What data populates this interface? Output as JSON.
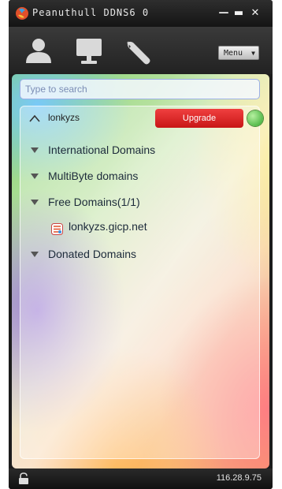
{
  "window": {
    "title": "Peanuthull DDNS6 0",
    "controls": {
      "minimize": "—",
      "maximize": "▬",
      "close": "✕"
    }
  },
  "toolbar": {
    "items": [
      {
        "icon": "user-icon"
      },
      {
        "icon": "monitor-icon"
      },
      {
        "icon": "wrench-icon"
      }
    ],
    "menu_label": "Menu",
    "menu_caret": "▼"
  },
  "search": {
    "placeholder": "Type to search",
    "value": ""
  },
  "account": {
    "name": "lonkyzs",
    "upgrade_label": "Upgrade",
    "status_color": "#2fa52a"
  },
  "groups": [
    {
      "label": "International Domains",
      "expanded": true
    },
    {
      "label": "MultiByte domains",
      "expanded": true
    },
    {
      "label": "Free Domains(1/1)",
      "expanded": true,
      "domains": [
        "lonkyzs.gicp.net"
      ]
    },
    {
      "label": "Donated Domains",
      "expanded": true
    }
  ],
  "status": {
    "ip": "116.28.9.75"
  },
  "colors": {
    "upgrade_red": "#e02525",
    "online_green": "#2fa52a",
    "search_border": "#9aaee6"
  }
}
